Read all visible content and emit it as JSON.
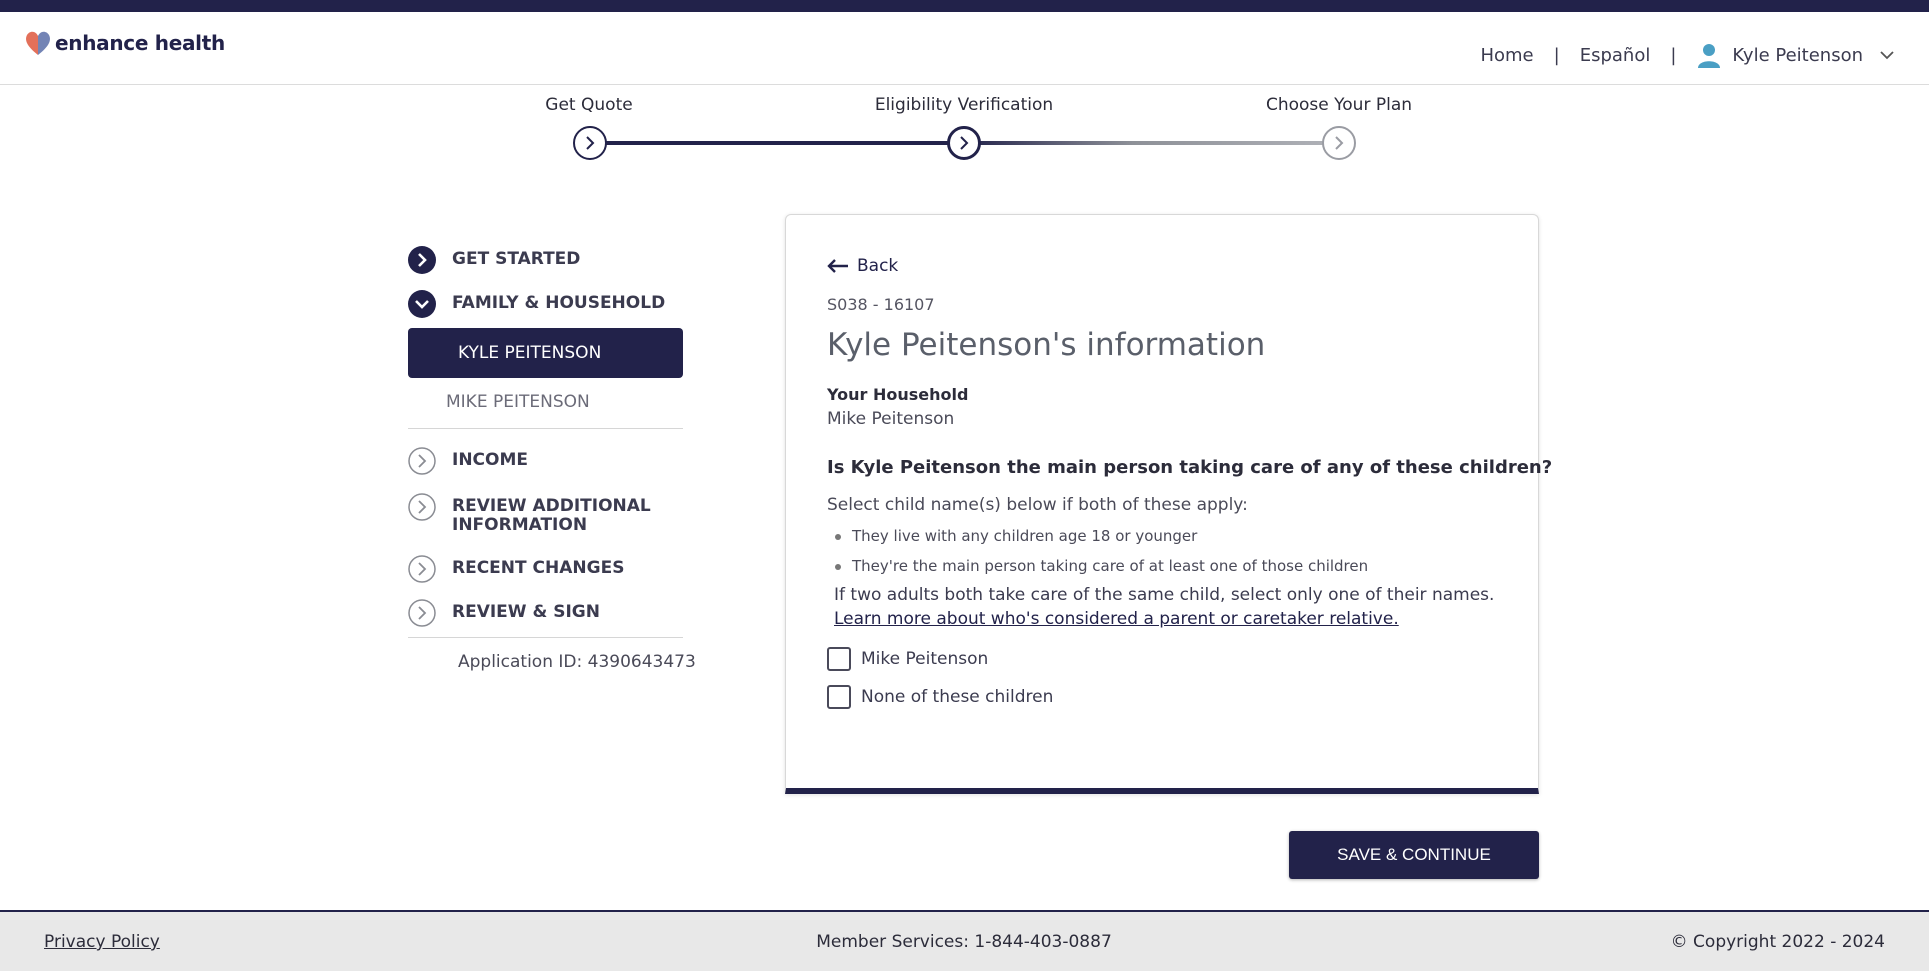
{
  "brand": {
    "name": "enhance health"
  },
  "nav": {
    "home": "Home",
    "language": "Español",
    "user_name": "Kyle Peitenson"
  },
  "stepper": {
    "steps": [
      {
        "label": "Get Quote",
        "status": "complete"
      },
      {
        "label": "Eligibility Verification",
        "status": "current"
      },
      {
        "label": "Choose Your Plan",
        "status": "upcoming"
      }
    ]
  },
  "sidebar": {
    "items": [
      {
        "label": "GET STARTED",
        "icon": "chevron-right-filled-icon"
      },
      {
        "label": "FAMILY & HOUSEHOLD",
        "icon": "chevron-down-filled-icon"
      },
      {
        "label": "INCOME",
        "icon": "chevron-right-outline-icon"
      },
      {
        "label": "REVIEW ADDITIONAL INFORMATION",
        "icon": "chevron-right-outline-icon"
      },
      {
        "label": "RECENT CHANGES",
        "icon": "chevron-right-outline-icon"
      },
      {
        "label": "REVIEW & SIGN",
        "icon": "chevron-right-outline-icon"
      }
    ],
    "sub_items": [
      {
        "label": "KYLE PEITENSON",
        "active": true
      },
      {
        "label": "MIKE PEITENSON",
        "active": false
      }
    ],
    "application_id": "Application ID: 4390643473"
  },
  "card": {
    "back": "Back",
    "case_id": "S038 - 16107",
    "title": "Kyle Peitenson's information",
    "household_label": "Your Household",
    "household_member": "Mike Peitenson",
    "question": "Is Kyle Peitenson the main person taking care of any of these children?",
    "instructions": "Select child name(s) below if both of these apply:",
    "bullets": [
      "They live with any children age 18 or younger",
      "They're the main person taking care of at least one of those children"
    ],
    "note": "If two adults both take care of the same child, select only one of their names.",
    "learn_more": "Learn more about who's considered a parent or caretaker relative.",
    "options": [
      {
        "label": "Mike Peitenson",
        "checked": false
      },
      {
        "label": "None of these children",
        "checked": false
      }
    ]
  },
  "actions": {
    "save_continue": "SAVE & CONTINUE"
  },
  "footer": {
    "privacy": "Privacy Policy",
    "member_services": "Member Services: 1-844-403-0887",
    "copyright": "© Copyright 2022 - 2024"
  },
  "colors": {
    "navy": "#22224a",
    "brand_heart_left": "#e3705a",
    "brand_heart_right": "#5b6fa8",
    "user_icon": "#4a9fc4"
  }
}
